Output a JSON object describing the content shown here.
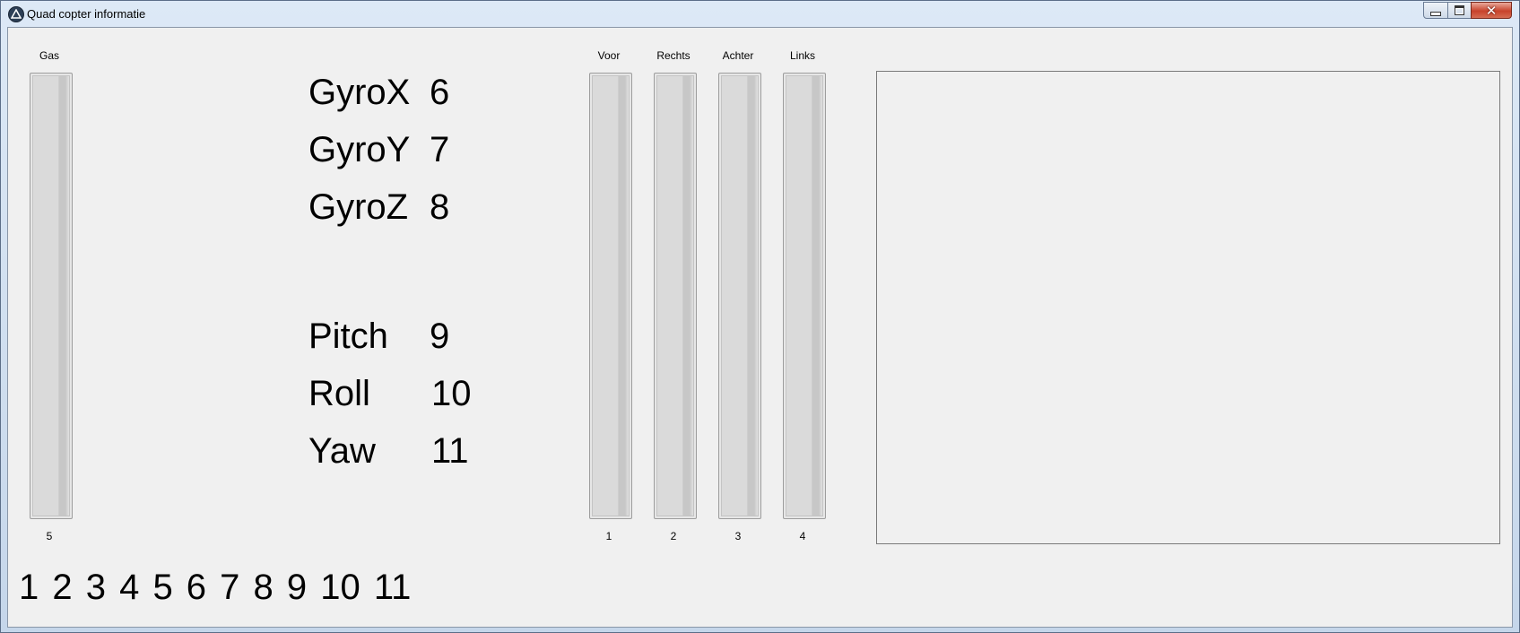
{
  "window": {
    "title": "Quad copter informatie",
    "close_glyph": "✕"
  },
  "gas": {
    "label": "Gas",
    "value": "5",
    "level": 0
  },
  "motors": [
    {
      "label": "Voor",
      "value": "1",
      "level": 0
    },
    {
      "label": "Rechts",
      "value": "2",
      "level": 0
    },
    {
      "label": "Achter",
      "value": "3",
      "level": 0
    },
    {
      "label": "Links",
      "value": "4",
      "level": 0
    }
  ],
  "readouts": [
    {
      "label": "GyroX",
      "value": "6"
    },
    {
      "label": "GyroY",
      "value": "7"
    },
    {
      "label": "GyroZ",
      "value": "8"
    },
    {
      "label": "Pitch",
      "value": "9"
    },
    {
      "label": "Roll",
      "value": "10"
    },
    {
      "label": "Yaw",
      "value": "11"
    }
  ],
  "sequence": "1 2 3 4 5 6 7 8 9 10 11",
  "icons": {
    "app": "app-icon",
    "minimize": "minimize-icon",
    "maximize": "maximize-icon",
    "close": "close-icon"
  }
}
